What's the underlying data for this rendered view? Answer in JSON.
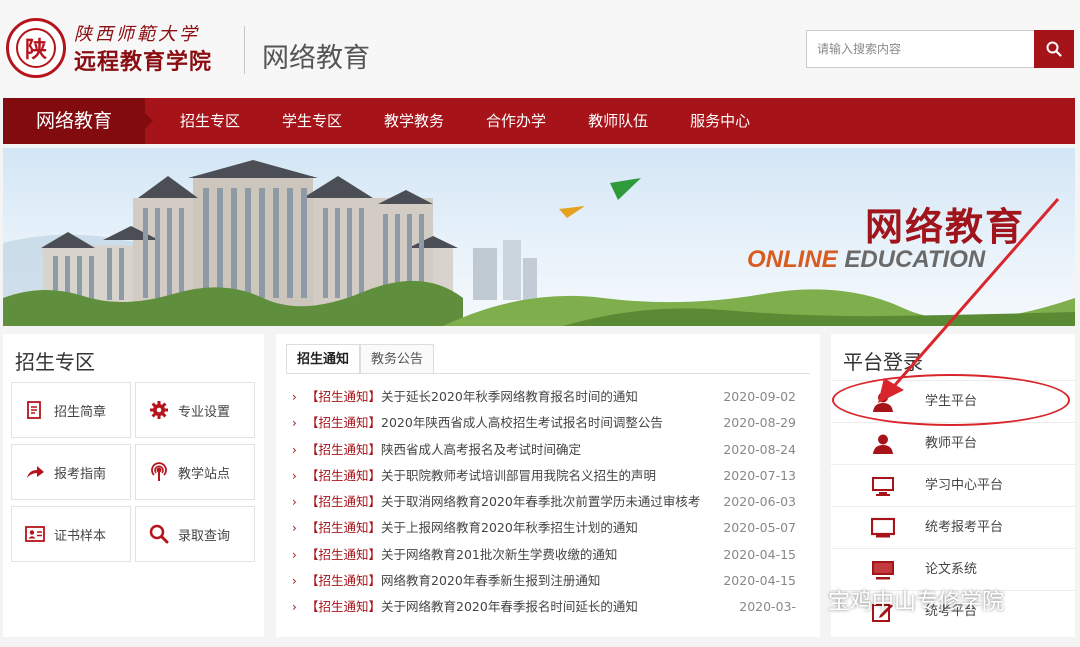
{
  "header": {
    "school_name": "陕西师範大学",
    "college_name": "远程教育学院",
    "section_title": "网络教育",
    "seal_char": "陕",
    "search_placeholder": "请输入搜索内容"
  },
  "nav": {
    "home": "网络教育",
    "items": [
      "招生专区",
      "学生专区",
      "教学教务",
      "合作办学",
      "教师队伍",
      "服务中心"
    ]
  },
  "banner": {
    "title": "网络教育",
    "en_word1": "ONLINE",
    "en_word2": "EDUCATION"
  },
  "enroll": {
    "title": "招生专区",
    "buttons": [
      {
        "label": "招生简章",
        "icon": "document-icon"
      },
      {
        "label": "专业设置",
        "icon": "gear-icon"
      },
      {
        "label": "报考指南",
        "icon": "share-arrow-icon"
      },
      {
        "label": "教学站点",
        "icon": "broadcast-icon"
      },
      {
        "label": "证书样本",
        "icon": "id-card-icon"
      },
      {
        "label": "录取查询",
        "icon": "search-icon"
      }
    ]
  },
  "news": {
    "tabs": [
      "招生通知",
      "教务公告"
    ],
    "items": [
      {
        "tag": "【招生通知】",
        "title": "关于延长2020年秋季网络教育报名时间的通知",
        "date": "2020-09-02"
      },
      {
        "tag": "【招生通知】",
        "title": "2020年陕西省成人高校招生考试报名时间调整公告",
        "date": "2020-08-29"
      },
      {
        "tag": "【招生通知】",
        "title": "陕西省成人高考报名及考试时间确定",
        "date": "2020-08-24"
      },
      {
        "tag": "【招生通知】",
        "title": "关于职院教师考试培训部冒用我院名义招生的声明",
        "date": "2020-07-13"
      },
      {
        "tag": "【招生通知】",
        "title": "关于取消网络教育2020年春季批次前置学历未通过审核考",
        "date": "2020-06-03"
      },
      {
        "tag": "【招生通知】",
        "title": "关于上报网络教育2020年秋季招生计划的通知",
        "date": "2020-05-07"
      },
      {
        "tag": "【招生通知】",
        "title": "关于网络教育201批次新生学费收缴的通知",
        "date": "2020-04-15"
      },
      {
        "tag": "【招生通知】",
        "title": "网络教育2020年春季新生报到注册通知",
        "date": "2020-04-15"
      },
      {
        "tag": "【招生通知】",
        "title": "关于网络教育2020年春季报名时间延长的通知",
        "date": "2020-03-"
      }
    ]
  },
  "platform": {
    "title": "平台登录",
    "items": [
      {
        "label": "学生平台",
        "icon": "user-icon"
      },
      {
        "label": "教师平台",
        "icon": "user-icon"
      },
      {
        "label": "学习中心平台",
        "icon": "monitor-icon"
      },
      {
        "label": "统考报考平台",
        "icon": "monitor-icon"
      },
      {
        "label": "论文系统",
        "icon": "monitor-icon"
      },
      {
        "label": "统考平台",
        "icon": "edit-icon"
      }
    ]
  },
  "watermark": "宝鸡中山专修学院",
  "colors": {
    "brand": "#a6141a",
    "brand_dark": "#820b10",
    "annotation": "#d8262c"
  }
}
